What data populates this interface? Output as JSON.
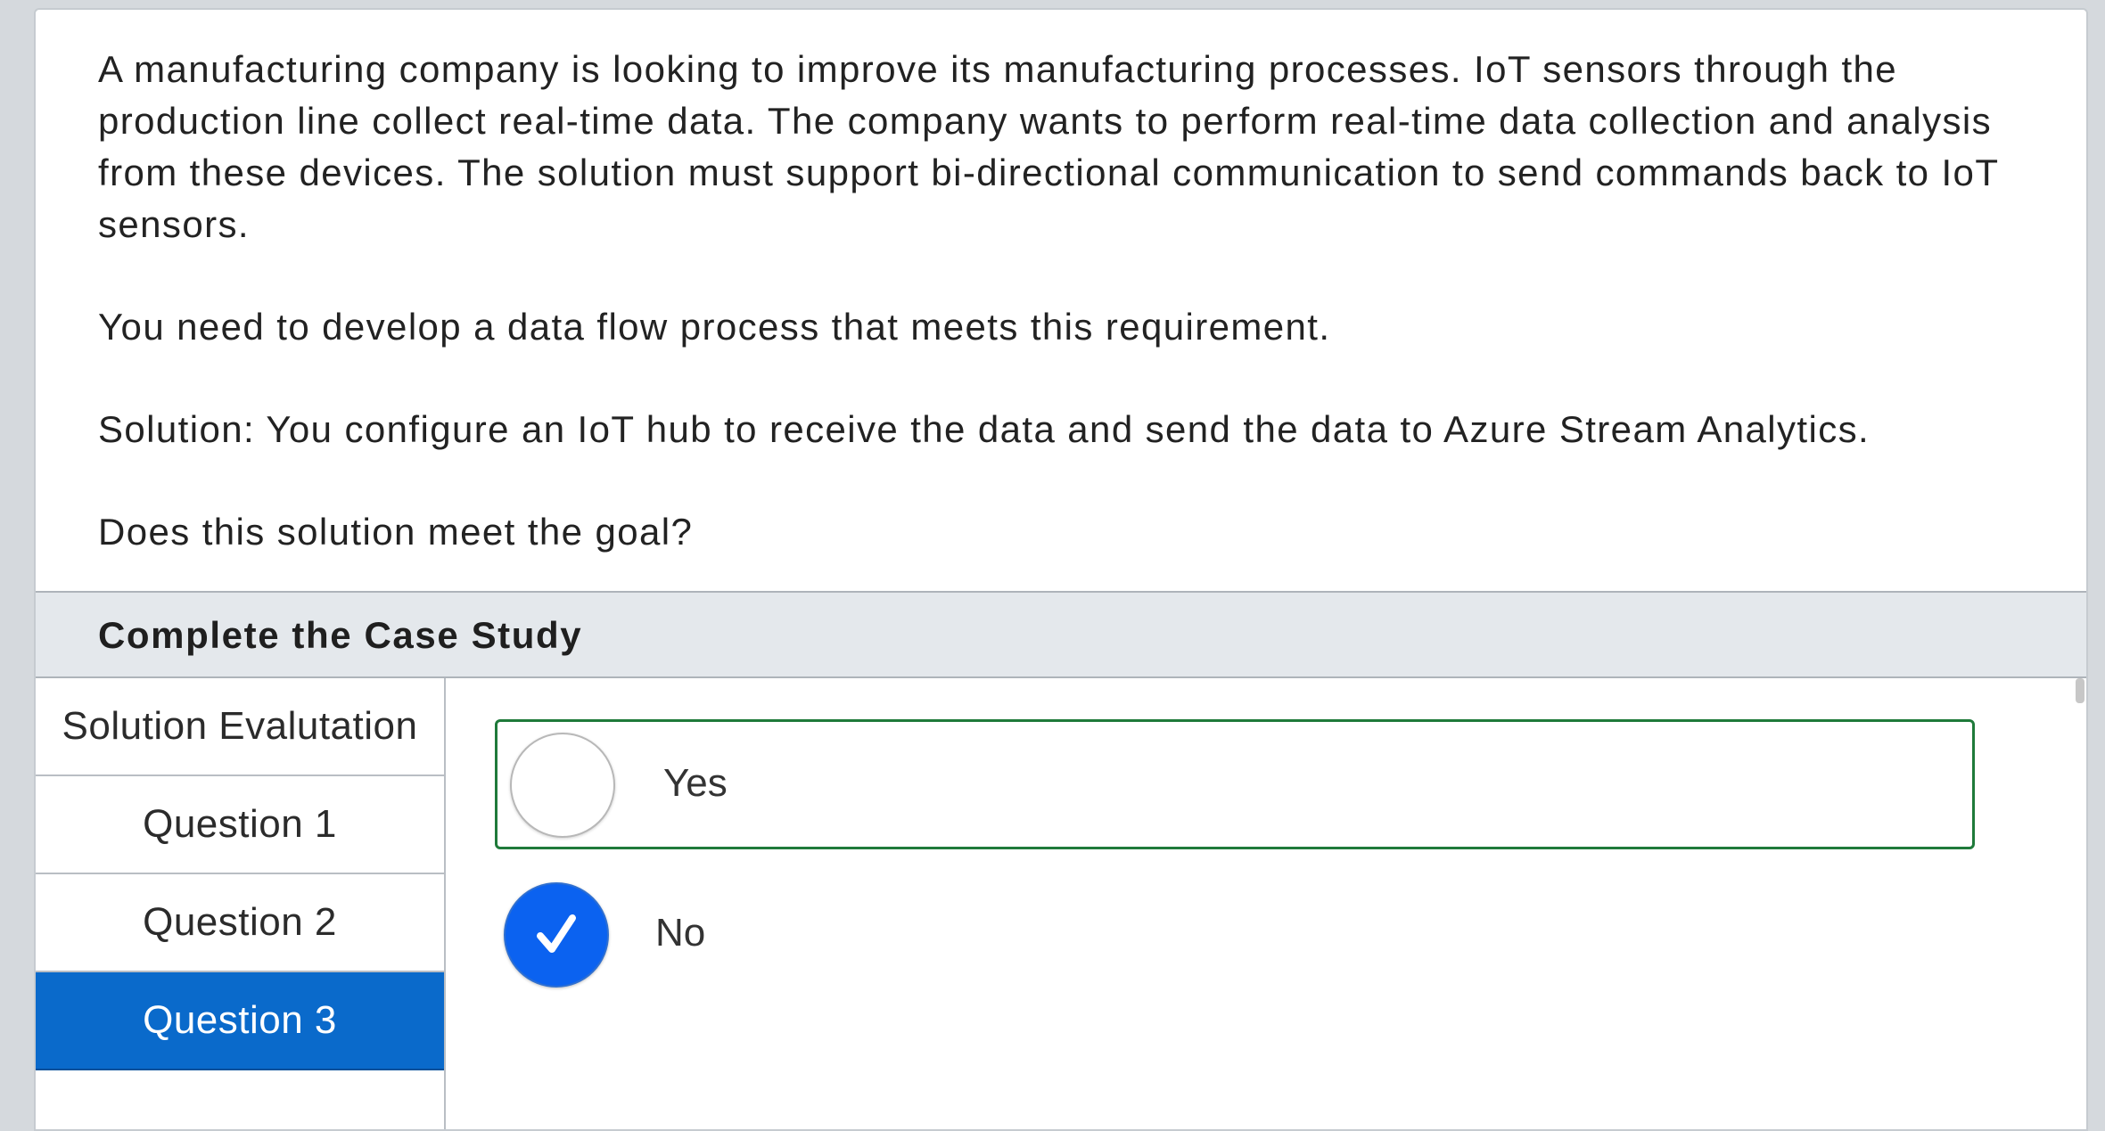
{
  "question": {
    "paragraphs": [
      "A manufacturing company is looking to improve its manufacturing processes. IoT sensors through the production line collect real-time data. The company wants to perform real-time data collection and analysis from these devices. The solution must support bi-directional communication to send commands back to IoT sensors.",
      "You need to develop a data flow process that meets this requirement.",
      "Solution: You configure an IoT hub to receive the data and send the data to Azure Stream Analytics.",
      "Does this solution meet the goal?"
    ]
  },
  "case_study": {
    "header": "Complete the Case Study"
  },
  "sidebar": {
    "items": [
      {
        "label": "Solution Evalutation",
        "active": false
      },
      {
        "label": "Question 1",
        "active": false
      },
      {
        "label": "Question 2",
        "active": false
      },
      {
        "label": "Question 3",
        "active": true
      }
    ]
  },
  "answers": {
    "options": [
      {
        "label": "Yes",
        "selected": false,
        "focused": true
      },
      {
        "label": "No",
        "selected": true,
        "focused": false
      }
    ]
  },
  "colors": {
    "active_tab": "#0a6acb",
    "selected_radio": "#0b62f0",
    "focus_border": "#1f7a3a",
    "header_bg": "#e4e8ec"
  },
  "icons": {
    "selected_radio": "checkmark-icon"
  }
}
